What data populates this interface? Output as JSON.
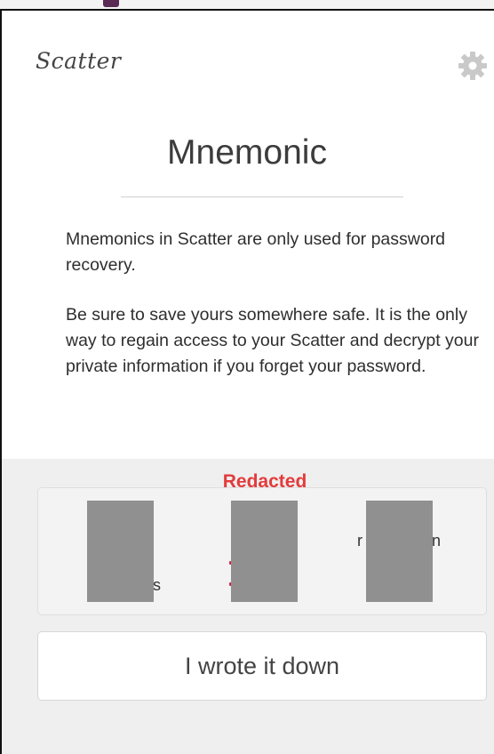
{
  "app": {
    "logo_text": "Scatter"
  },
  "header": {
    "settings_icon": "gear-icon"
  },
  "page": {
    "title": "Mnemonic",
    "paragraph_1": "Mnemonics in Scatter are only used for password recovery.",
    "paragraph_2": "Be sure to save yours somewhere safe. It is the only way to regain access to your Scatter and decrypt your private information if you forget your password."
  },
  "mnemonic": {
    "redaction_label": "Redacted",
    "visible_fragments": [
      "s",
      "r",
      "n"
    ]
  },
  "actions": {
    "confirm_label": "I wrote it down"
  },
  "colors": {
    "redaction_label": "#e33b3b",
    "redaction_block": "#909090",
    "panel_bg": "#efefef"
  }
}
